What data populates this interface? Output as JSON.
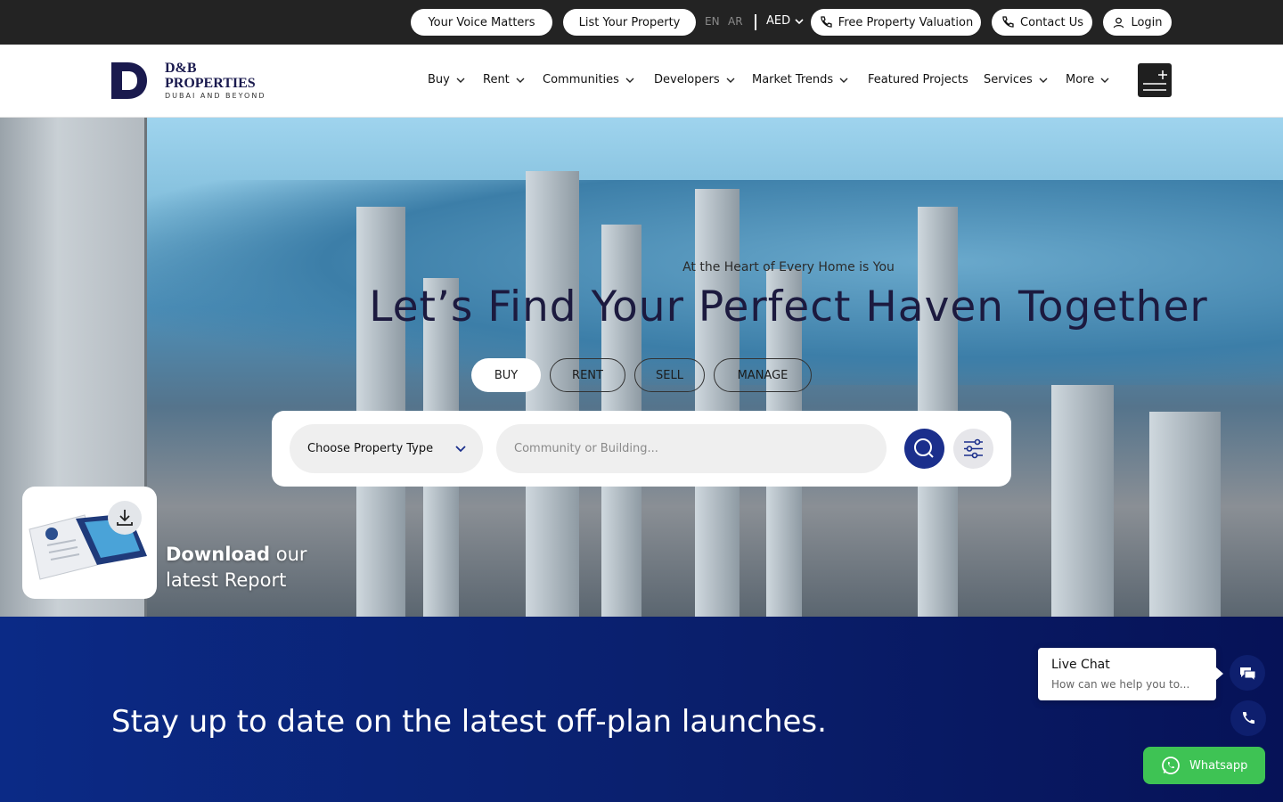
{
  "topbar": {
    "voice_label": "Your Voice Matters",
    "list_label": "List Your Property",
    "lang_en": "EN",
    "lang_ar": "AR",
    "currency": "AED",
    "valuation_label": "Free Property Valuation",
    "contact_label": "Contact Us",
    "login_label": "Login"
  },
  "brand": {
    "name_line1": "D&B",
    "name_line2": "PROPERTIES",
    "tagline": "DUBAI AND BEYOND",
    "color": "#1a1a4e"
  },
  "nav": {
    "buy": "Buy",
    "rent": "Rent",
    "communities": "Communities",
    "developers": "Developers",
    "market_trends": "Market Trends",
    "featured_projects": "Featured Projects",
    "services": "Services",
    "more": "More"
  },
  "hero": {
    "subtitle": "At the Heart of Every Home is You",
    "title": "Let’s Find Your Perfect Haven Together",
    "tabs": {
      "buy": "BUY",
      "rent": "RENT",
      "sell": "SELL",
      "manage": "MANAGE"
    },
    "property_type": "Choose Property Type",
    "community_placeholder": "Community or Building..."
  },
  "report": {
    "line1_bold": "Download",
    "line1_rest": " our",
    "line2": "latest Report"
  },
  "band": {
    "title": "Stay up to date on the latest off-plan launches.",
    "color": "#0b2a86"
  },
  "chat": {
    "title": "Live Chat",
    "subtitle": "How can we help you to..."
  },
  "whatsapp": {
    "label": "Whatsapp",
    "color": "#3ec354"
  },
  "icons": {
    "phone": "phone-icon",
    "user": "user-icon",
    "chevron": "chevron-down-icon",
    "search": "search-icon",
    "filter": "filter-icon",
    "download": "download-icon",
    "chat": "chat-icon",
    "whatsapp": "whatsapp-icon",
    "menu": "menu-icon"
  }
}
